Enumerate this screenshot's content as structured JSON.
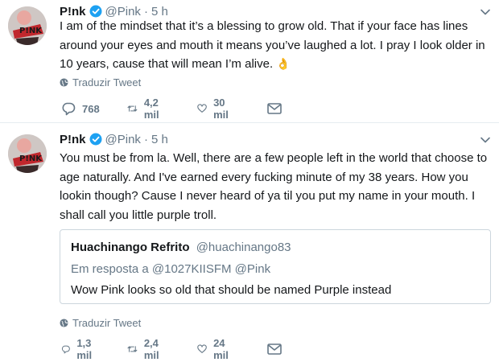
{
  "tweets": [
    {
      "author_name": "P!nk",
      "author_handle": "@Pink",
      "separator": "·",
      "time": "5 h",
      "text_lines": [
        "I am of the mindset that it’s a blessing to grow old. That if your face has lines",
        "around your eyes and mouth it means you’ve laughed a lot. I pray I look older in",
        "10 years, cause that will mean I’m alive."
      ],
      "emoji": "👌",
      "translate_label": "Traduzir Tweet",
      "reply_count": "768",
      "retweet_count": "4,2 mil",
      "like_count": "30 mil"
    },
    {
      "author_name": "P!nk",
      "author_handle": "@Pink",
      "separator": "·",
      "time": "5 h",
      "text_lines": [
        "You must be from la. Well, there are a few people left in the world that choose to",
        "age naturally. And I've earned every fucking minute of my 38 years. How you",
        "lookin though? Cause I never heard of ya til you put my name in your mouth. I",
        "shall call you little purple troll."
      ],
      "quote": {
        "author_name": "Huachinango Refrito",
        "author_handle": "@huachinango83",
        "reply_prefix": "Em resposta a",
        "reply_to_1": "@1027KIISFM",
        "reply_to_2": "@Pink",
        "text": "Wow Pink looks so old that should be named Purple instead"
      },
      "translate_label": "Traduzir Tweet",
      "reply_count": "1,3 mil",
      "retweet_count": "2,4 mil",
      "like_count": "24 mil"
    }
  ],
  "icons": {
    "verified": "verified-badge-icon",
    "caret": "chevron-down-icon",
    "globe": "globe-icon",
    "reply": "reply-icon",
    "retweet": "retweet-icon",
    "like": "heart-icon",
    "message": "envelope-icon"
  },
  "colors": {
    "text": "#14171a",
    "secondary": "#657786",
    "verified": "#1da1f2",
    "border": "#e6ecf0"
  }
}
